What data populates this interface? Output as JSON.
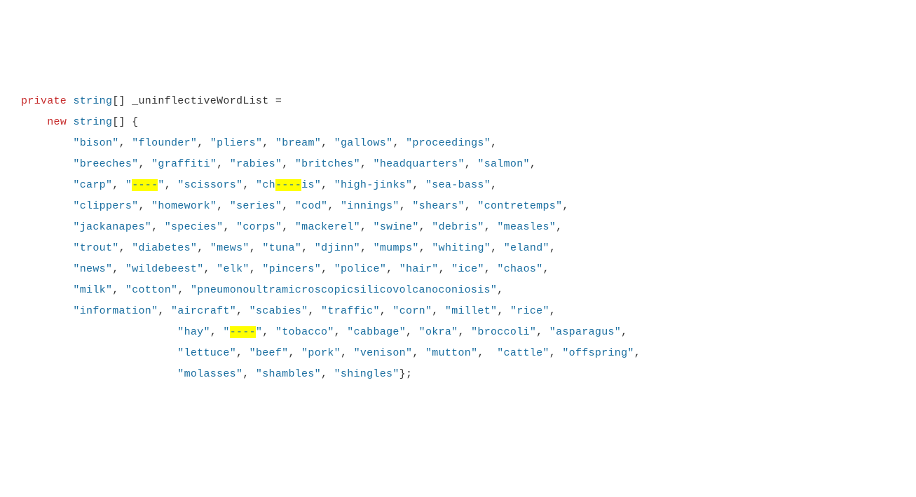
{
  "code": {
    "kw_private": "private",
    "kw_string1": "string",
    "brackets1": "[]",
    "ident": "_uninflectiveWordList",
    "eq": "=",
    "kw_new": "new",
    "kw_string2": "string",
    "brackets2": "[]",
    "brace_open": "{",
    "brace_close_semi": "};",
    "comma": ",",
    "quote": "\""
  },
  "censor": "----",
  "words": {
    "l1": [
      "bison",
      "flounder",
      "pliers",
      "bream",
      "gallows",
      "proceedings"
    ],
    "l2": [
      "breeches",
      "graffiti",
      "rabies",
      "britches",
      "headquarters",
      "salmon"
    ],
    "l3_pre_censor": [
      "carp"
    ],
    "l3_censor1": "----",
    "l3_mid1": [
      "scissors"
    ],
    "l3_split_pre": "ch",
    "l3_split_censor": "----",
    "l3_split_post": "is",
    "l3_post": [
      "high-jinks",
      "sea-bass"
    ],
    "l4": [
      "clippers",
      "homework",
      "series",
      "cod",
      "innings",
      "shears",
      "contretemps"
    ],
    "l5": [
      "jackanapes",
      "species",
      "corps",
      "mackerel",
      "swine",
      "debris",
      "measles"
    ],
    "l6": [
      "trout",
      "diabetes",
      "mews",
      "tuna",
      "djinn",
      "mumps",
      "whiting",
      "eland"
    ],
    "l7": [
      "news",
      "wildebeest",
      "elk",
      "pincers",
      "police",
      "hair",
      "ice",
      "chaos"
    ],
    "l8": [
      "milk",
      "cotton",
      "pneumonoultramicroscopicsilicovolcanoconiosis"
    ],
    "l9": [
      "information",
      "aircraft",
      "scabies",
      "traffic",
      "corn",
      "millet",
      "rice"
    ],
    "l10_pre": [
      "hay"
    ],
    "l10_censor": "----",
    "l10_post": [
      "tobacco",
      "cabbage",
      "okra",
      "broccoli",
      "asparagus"
    ],
    "l11": [
      "lettuce",
      "beef",
      "pork",
      "venison",
      "mutton",
      "cattle",
      "offspring"
    ],
    "l12": [
      "molasses",
      "shambles",
      "shingles"
    ]
  }
}
